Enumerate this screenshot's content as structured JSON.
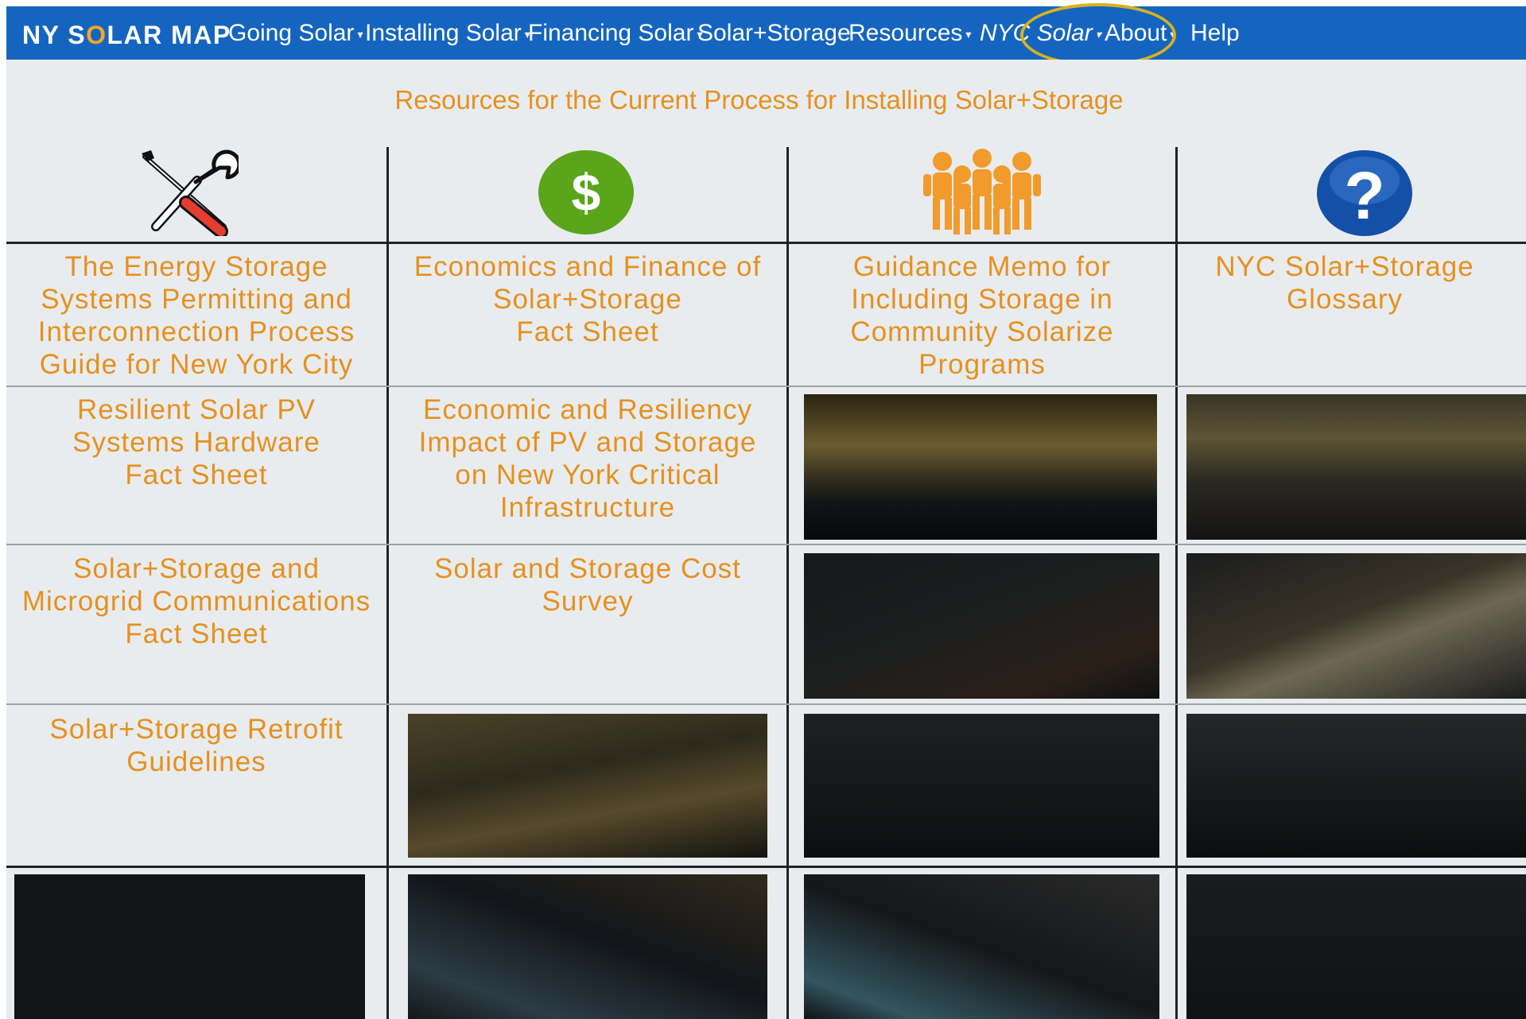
{
  "nav": {
    "logo_before": "NY S",
    "logo_o": "O",
    "logo_after": "LAR MAP",
    "items": [
      {
        "label": "Going Solar",
        "dropdown": true
      },
      {
        "label": "Installing Solar",
        "dropdown": true
      },
      {
        "label": "Financing Solar",
        "dropdown": true
      },
      {
        "label": "Solar+Storage",
        "dropdown": false
      },
      {
        "label": "Resources",
        "dropdown": true,
        "highlighted": true
      },
      {
        "label": "NYC Solar",
        "dropdown": true
      },
      {
        "label": "About",
        "dropdown": true
      },
      {
        "label": "Help",
        "dropdown": false
      }
    ],
    "caret": "▾"
  },
  "page": {
    "title": "Resources for the Current Process for Installing Solar+Storage"
  },
  "icons": [
    "tools-icon",
    "dollar-icon",
    "people-icon",
    "help-icon"
  ],
  "resources": [
    {
      "lines": [
        "The Energy Storage",
        "Systems Permitting and",
        "Interconnection Process",
        "Guide for New York City"
      ]
    },
    {
      "lines": [
        "Economics and Finance of",
        "Solar+Storage",
        "Fact Sheet"
      ]
    },
    {
      "lines": [
        "Guidance Memo for",
        "Including Storage in",
        "Community Solarize",
        "Programs"
      ]
    },
    {
      "lines": [
        "NYC Solar+Storage",
        "Glossary"
      ]
    },
    {
      "lines": [
        "Resilient Solar PV",
        "Systems Hardware",
        "Fact Sheet"
      ]
    },
    {
      "lines": [
        "Economic and Resiliency",
        "Impact of PV and Storage",
        "on New York Critical",
        "Infrastructure"
      ]
    },
    {
      "lines": [
        "Solar+Storage and",
        "Microgrid Communications",
        "Fact Sheet"
      ]
    },
    {
      "lines": [
        "Solar and Storage Cost",
        "Survey"
      ]
    },
    {
      "lines": [
        "Solar+Storage Retrofit",
        "Guidelines"
      ]
    }
  ],
  "colors": {
    "nav_bg": "#1565c0",
    "accent_orange": "#e7901d",
    "highlight_ring": "#d8b11c",
    "content_bg": "#e8ecef",
    "dollar_green": "#5aa51a",
    "help_blue": "#1450a8"
  }
}
